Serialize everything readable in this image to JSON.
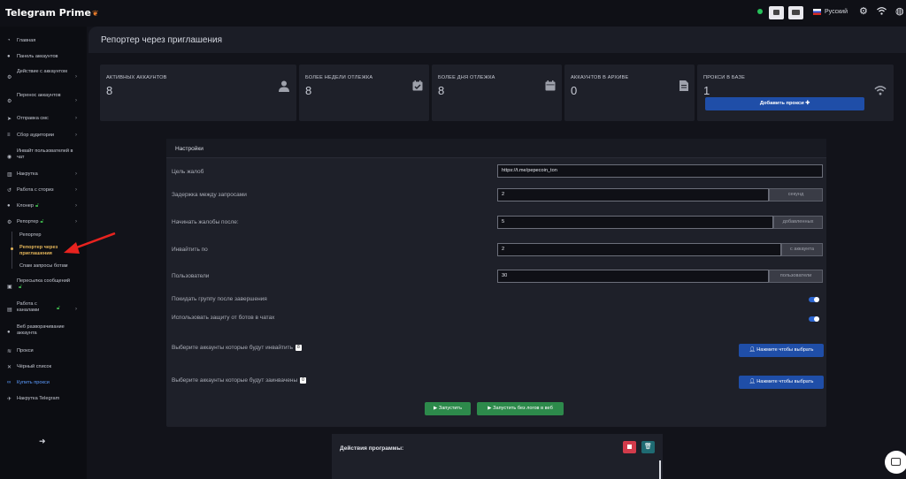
{
  "app": {
    "logo": "Telegram Prime",
    "language": "Русский"
  },
  "sidebar": {
    "items": [
      {
        "label": "Главная",
        "icon": "speedometer-icon"
      },
      {
        "label": "Панель аккаунтов",
        "icon": "users-icon"
      },
      {
        "label": "Действие с аккаунтом",
        "icon": "gear-icon"
      },
      {
        "label": "Перенос аккаунтов",
        "icon": "gear-icon"
      },
      {
        "label": "Отправка смс",
        "icon": "send-icon"
      },
      {
        "label": "Сбор аудитории",
        "icon": "database-icon"
      },
      {
        "label": "Инвайт пользователей в чат",
        "icon": "eye-icon"
      },
      {
        "label": "Накрутка",
        "icon": "chart-icon"
      },
      {
        "label": "Работа с сториз",
        "icon": "history-icon"
      },
      {
        "label": "Клонер",
        "icon": "user-icon"
      },
      {
        "label": "Репортер",
        "icon": "gear-icon"
      }
    ],
    "sub_items": [
      "Репортер",
      "Репортер через приглашения",
      "Спам запросы ботам"
    ],
    "items_after": [
      {
        "label": "Пересылка сообщений",
        "icon": "forward-icon"
      },
      {
        "label": "Работа с каналами",
        "icon": "channel-icon"
      },
      {
        "label": "Веб разворачивание аккаунта",
        "icon": "user-icon"
      },
      {
        "label": "Прокси",
        "icon": "wifi-icon"
      },
      {
        "label": "Чёрный список",
        "icon": "close-icon"
      },
      {
        "label": "Купить прокси",
        "icon": "link-icon"
      },
      {
        "label": "Накрутка Telegram",
        "icon": "telegram-icon"
      }
    ]
  },
  "page": {
    "title": "Репортер через приглашения"
  },
  "stats": [
    {
      "title": "АКТИВНЫХ АККАУНТОВ",
      "value": "8",
      "icon": "user-icon"
    },
    {
      "title": "БОЛЕЕ НЕДЕЛИ ОТЛЕЖКА",
      "value": "8",
      "icon": "calendar-check-icon"
    },
    {
      "title": "БОЛЕЕ ДНЯ ОТЛЕЖКА",
      "value": "8",
      "icon": "calendar-icon"
    },
    {
      "title": "АККАУНТОВ В АРХИВЕ",
      "value": "0",
      "icon": "file-icon"
    },
    {
      "title": "ПРОКСИ В БАЗЕ",
      "value": "1",
      "icon": "wifi-icon",
      "button": "Добавить прокси ✚"
    }
  ],
  "settings": {
    "title": "Настройки",
    "fields": {
      "target": {
        "label": "Цель жалоб",
        "value": "https://t.me/pepecoin_ton"
      },
      "delay": {
        "label": "Задержка между запросами",
        "value": "2",
        "addon": "секунд"
      },
      "start_after": {
        "label": "Начинать жалобы после:",
        "value": "5",
        "addon": "добавленных"
      },
      "invite_per": {
        "label": "Инвайтить по",
        "value": "2",
        "addon": "с аккаунта"
      },
      "users": {
        "label": "Пользователи",
        "value": "30",
        "addon": "пользователи"
      }
    },
    "toggles": [
      {
        "label": "Покидать группу после завершения",
        "on": true
      },
      {
        "label": "Использовать защиту от ботов в чатах",
        "on": true
      }
    ],
    "pickers": [
      {
        "label": "Выберите аккаунты которые будут инвайтить",
        "count": "8",
        "button": "Нажмите чтобы выбрать"
      },
      {
        "label": "Выберите аккаунты которые будут заинвачены",
        "count": "0",
        "button": "Нажмите чтобы выбрать"
      }
    ],
    "run_button": "Запустить",
    "run_nolog_button": "Запустить без логов в веб"
  },
  "actions": {
    "title": "Действия программы:"
  },
  "colors": {
    "accent": "#1f4ea8",
    "success": "#2d8a4b",
    "danger": "#d23b4b",
    "active_nav": "#e5b65a"
  }
}
